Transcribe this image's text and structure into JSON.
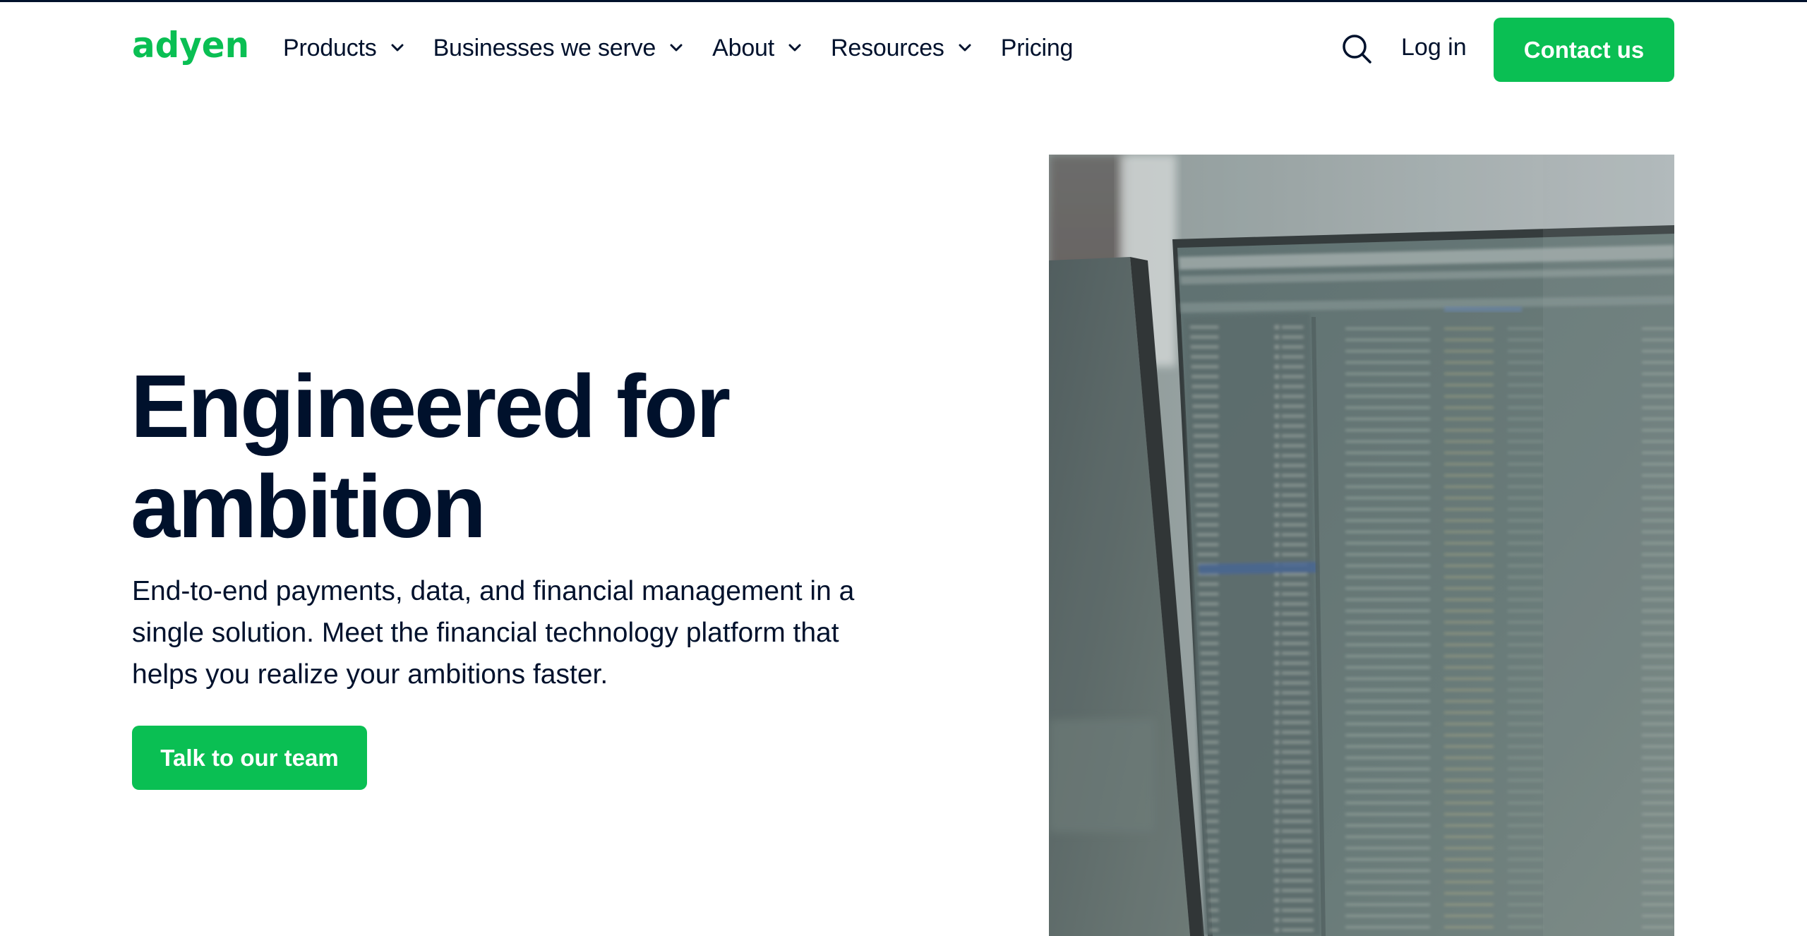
{
  "header": {
    "logo_text": "adyen",
    "nav": [
      {
        "label": "Products",
        "has_dropdown": true
      },
      {
        "label": "Businesses we serve",
        "has_dropdown": true
      },
      {
        "label": "About",
        "has_dropdown": true
      },
      {
        "label": "Resources",
        "has_dropdown": true
      },
      {
        "label": "Pricing",
        "has_dropdown": false
      }
    ],
    "search_icon": "search-icon",
    "login_label": "Log in",
    "contact_label": "Contact us"
  },
  "hero": {
    "title_line1": "Engineered for",
    "title_line2": "ambition",
    "subtitle": "End-to-end payments, data, and financial management in a single solution. Meet the financial technology platform that helps you realize your ambitions faster.",
    "cta_label": "Talk to our team"
  },
  "colors": {
    "brand_green": "#0abf53",
    "text_navy": "#00112c",
    "background": "#ffffff"
  }
}
